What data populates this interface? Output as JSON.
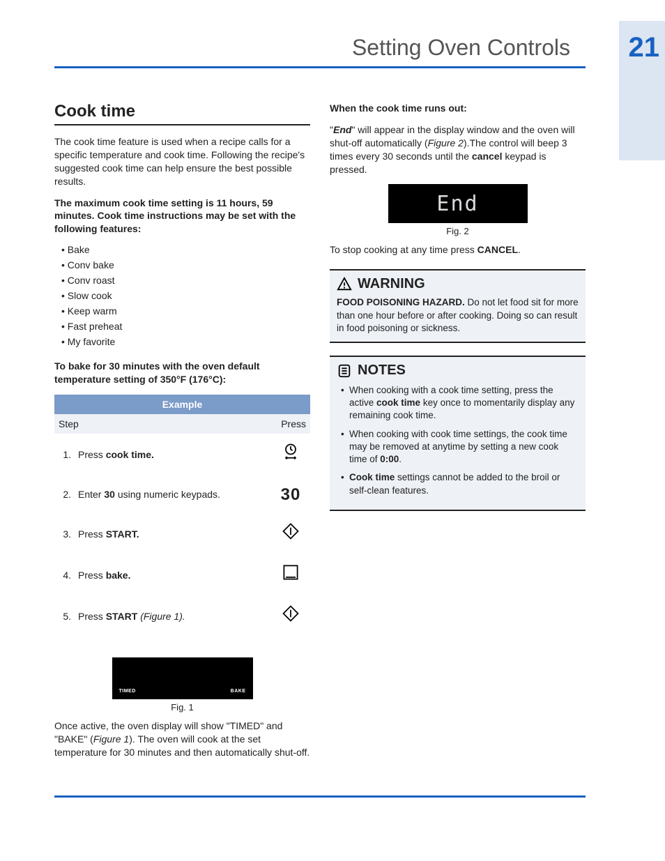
{
  "header": {
    "title": "Setting Oven Controls",
    "page_number": "21"
  },
  "section": {
    "title": "Cook time"
  },
  "intro": "The cook time feature is used when a recipe calls for a specific temperature and cook time. Following the recipe's suggested cook time can help ensure the best possible results.",
  "max_setting": "The maximum cook time setting is 11 hours, 59 minutes. Cook time instructions may be set with the following features:",
  "features": [
    "Bake",
    "Conv bake",
    "Conv roast",
    "Slow cook",
    "Keep warm",
    "Fast preheat",
    "My favorite"
  ],
  "bake_instructions_heading": "To bake for 30 minutes with the oven default temperature setting of 350°F (176°C):",
  "table": {
    "header": "Example",
    "col_step": "Step",
    "col_press": "Press",
    "rows": [
      {
        "num": "1.",
        "pre": "Press ",
        "bold": "cook time.",
        "post": "",
        "icon": "clock"
      },
      {
        "num": "2.",
        "pre": "Enter ",
        "bold": "30",
        "post": " using numeric keypads.",
        "icon": "30"
      },
      {
        "num": "3.",
        "pre": "Press ",
        "bold": "START.",
        "post": "",
        "icon": "start"
      },
      {
        "num": "4.",
        "pre": "Press ",
        "bold": "bake.",
        "post": "",
        "icon": "bake"
      },
      {
        "num": "5.",
        "pre": "Press ",
        "bold": "START",
        "post": "",
        "italic": " (Figure 1).",
        "icon": "start"
      }
    ]
  },
  "fig1": {
    "timed": "TIMED",
    "bake": "BAKE",
    "caption": "Fig. 1"
  },
  "after_fig1_pre": "Once active, the oven display will show \"TIMED\" and  \"BAKE\" (",
  "after_fig1_italic": "Figure 1",
  "after_fig1_post": "). The oven will cook at the set temperature for 30 minutes and then automatically shut-off.",
  "col2_heading": "When the cook time runs out:",
  "col2_p1_open": "\"",
  "col2_p1_end": "End",
  "col2_p1_mid": "\" will appear in the display window and the oven will shut-off automatically (",
  "col2_p1_fig": "Figure 2",
  "col2_p1_close1": ").The control will beep 3 times every 30 seconds until the ",
  "col2_p1_cancel": "cancel",
  "col2_p1_close2": " keypad is pressed.",
  "fig2": {
    "text": "End",
    "caption": "Fig. 2"
  },
  "stop_pre": "To stop cooking at any time press ",
  "stop_bold": "CANCEL",
  "stop_post": ".",
  "warning": {
    "title": "WARNING",
    "bold": "FOOD POISONING HAZARD.",
    "text": " Do not let food sit for more than one hour before or after cooking. Doing so can result in food poisoning or sickness."
  },
  "notes": {
    "title": "NOTES",
    "items": [
      {
        "pre": "When cooking with a cook time setting, press the active ",
        "bold": "cook time",
        "post": " key once to momentarily display any remaining cook time."
      },
      {
        "pre": "When cooking with cook time settings, the cook time may be removed at anytime by setting a new cook time of ",
        "bold": "0:00",
        "post": "."
      },
      {
        "boldlead": "Cook time",
        "post": " settings cannot be added to the broil or self-clean features."
      }
    ]
  }
}
